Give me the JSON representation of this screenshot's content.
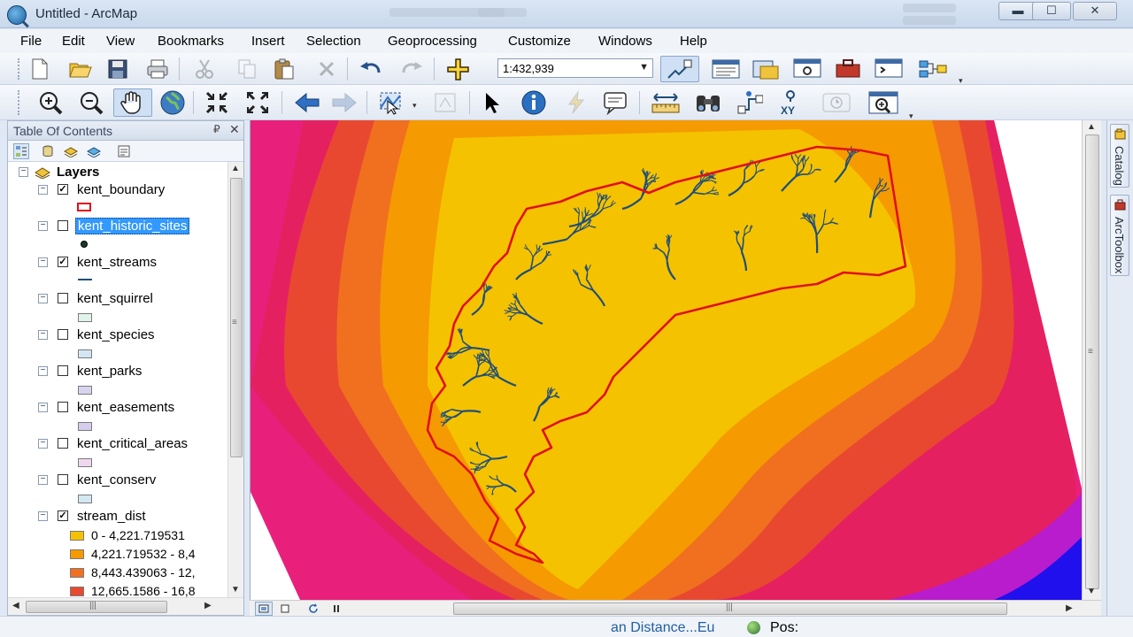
{
  "window": {
    "title": "Untitled - ArcMap",
    "buttons": {
      "minimize": "▬",
      "maximize": "☐",
      "close": "✕"
    }
  },
  "menu": [
    "File",
    "Edit",
    "View",
    "Bookmarks",
    "Insert",
    "Selection",
    "Geoprocessing",
    "Customize",
    "Windows",
    "Help"
  ],
  "standard_toolbar": {
    "scale": "1:432,939",
    "tools": [
      "new-document",
      "open",
      "save",
      "print",
      "cut",
      "copy",
      "paste",
      "delete",
      "undo",
      "redo",
      "add-data",
      "editor-toolbar",
      "table-of-contents",
      "catalog-window",
      "search-window",
      "arctoolbox",
      "python-window",
      "model-builder"
    ]
  },
  "tools_toolbar": {
    "tools": [
      "zoom-in",
      "zoom-out",
      "pan",
      "full-extent",
      "fixed-zoom-in",
      "fixed-zoom-out",
      "previous-extent",
      "next-extent",
      "select-features",
      "clear-selection",
      "select-elements",
      "identify",
      "hyperlink",
      "html-popup",
      "measure",
      "find",
      "find-route",
      "go-to-xy",
      "time-slider",
      "create-viewer-window"
    ]
  },
  "toc": {
    "title": "Table Of Contents",
    "pin": "₽",
    "close": "✕",
    "root": "Layers",
    "layers": [
      {
        "name": "kent_boundary",
        "checked": true,
        "symbol": "boundary",
        "selected": false
      },
      {
        "name": "kent_historic_sites",
        "checked": false,
        "symbol": "point",
        "selected": true
      },
      {
        "name": "kent_streams",
        "checked": true,
        "symbol": "line",
        "selected": false
      },
      {
        "name": "kent_squirrel",
        "checked": false,
        "symbol": "poly",
        "color": "#e2f3ea",
        "selected": false
      },
      {
        "name": "kent_species",
        "checked": false,
        "symbol": "poly",
        "color": "#d4e6f4",
        "selected": false
      },
      {
        "name": "kent_parks",
        "checked": false,
        "symbol": "poly",
        "color": "#d9d4ee",
        "selected": false
      },
      {
        "name": "kent_easements",
        "checked": false,
        "symbol": "poly",
        "color": "#d6cdee",
        "selected": false
      },
      {
        "name": "kent_critical_areas",
        "checked": false,
        "symbol": "poly",
        "color": "#eed8ee",
        "selected": false
      },
      {
        "name": "kent_conserv",
        "checked": false,
        "symbol": "poly",
        "color": "#d4e8f2",
        "selected": false
      },
      {
        "name": "stream_dist",
        "checked": true,
        "symbol": "none",
        "selected": false
      }
    ],
    "stream_dist_classes": [
      {
        "label": "0 - 4,221.719531",
        "color": "#f5c200"
      },
      {
        "label": "4,221.719532 - 8,4",
        "color": "#f59a00"
      },
      {
        "label": "8,443.439063 - 12,",
        "color": "#f07020"
      },
      {
        "label": "12,665.1586 - 16,8",
        "color": "#e84830"
      }
    ]
  },
  "dock": {
    "tab1": "Catalog",
    "tab2": "ArcToolbox"
  },
  "status": {
    "geo": "an Distance...Eu",
    "pos": "Pos:"
  },
  "colors": {
    "boundary": "#e0101c",
    "streams": "#1f4e79",
    "selection": "#3399ff",
    "dist_bands": [
      "#f5c200",
      "#f59a00",
      "#f07020",
      "#e84830",
      "#e52060",
      "#e8207c",
      "#b81ccc",
      "#2010ee"
    ]
  }
}
